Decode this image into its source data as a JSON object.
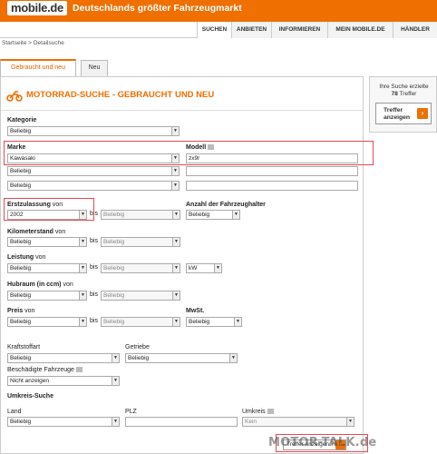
{
  "header": {
    "logo": "mobile.de",
    "tagline": "Deutschlands größter Fahrzeugmarkt",
    "nav": [
      "SUCHEN",
      "ANBIETEN",
      "INFORMIEREN",
      "MEIN MOBILE.DE",
      "HÄNDLER"
    ]
  },
  "breadcrumb": "Startseite > Detailsuche",
  "tabs": [
    "Gebraucht und neu",
    "Neu"
  ],
  "panel_title": "MOTORRAD-SUCHE - GEBRAUCHT UND NEU",
  "form": {
    "kategorie_label": "Kategorie",
    "kategorie_value": "Beliebig",
    "marke_label": "Marke",
    "marke_value": "Kawasaki",
    "modell_label": "Modell",
    "modell_value": "zx9r",
    "extra_marke_value": "Beliebig",
    "erstzulassung_label": "Erstzulassung",
    "von": "von",
    "bis": "bis",
    "erstzulassung_von": "2002",
    "erstzulassung_bis": "Beliebig",
    "halter_label": "Anzahl der Fahrzeughalter",
    "halter_value": "Beliebig",
    "km_label": "Kilometerstand",
    "km_von": "Beliebig",
    "km_bis": "Beliebig",
    "leistung_label": "Leistung",
    "leistung_von": "Beliebig",
    "leistung_bis": "Beliebig",
    "leistung_unit": "kW",
    "hubraum_label": "Hubraum (in ccm)",
    "hubraum_von": "Beliebig",
    "hubraum_bis": "Beliebig",
    "preis_label": "Preis",
    "preis_von": "Beliebig",
    "preis_bis": "Beliebig",
    "mwst_label": "MwSt.",
    "mwst_value": "Beliebig",
    "kraftstoff_label": "Kraftstoffart",
    "kraftstoff_value": "Beliebig",
    "getriebe_label": "Getriebe",
    "getriebe_value": "Beliebig",
    "beschaedigt_label": "Beschädigte Fahrzeuge",
    "beschaedigt_value": "Nicht anzeigen",
    "umkreis_title": "Umkreis-Suche",
    "land_label": "Land",
    "land_value": "Beliebig",
    "plz_label": "PLZ",
    "plz_value": "",
    "umkreis_label": "Umkreis",
    "umkreis_value": "Kein"
  },
  "result_box": {
    "line1": "Ihre Suche erzielte",
    "count": "78",
    "line2": "Treffer",
    "button_l1": "Treffer",
    "button_l2": "anzeigen"
  },
  "bottom_button": "Treffer anzeigen 78",
  "watermark": "MOTOR-TALK.de",
  "colors": {
    "brand": "#ef6f00",
    "highlight": "#e8484f"
  }
}
